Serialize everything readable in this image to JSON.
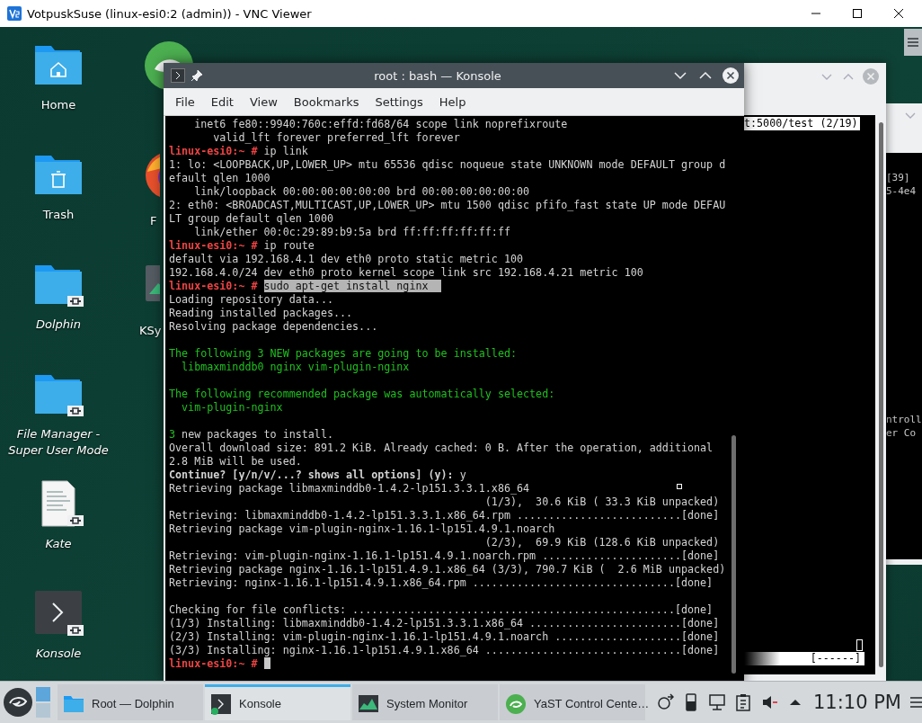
{
  "vnc_window": {
    "title": "VotpuskSuse (linux-esi0:2 (admin)) - VNC Viewer"
  },
  "desktop_icons": [
    {
      "label": "Home",
      "kind": "home",
      "link": false
    },
    {
      "label": "Trash",
      "kind": "trash",
      "link": false
    },
    {
      "label": "Dolphin",
      "kind": "folder",
      "link": true
    },
    {
      "label": "File Manager - Super User Mode",
      "kind": "folder",
      "link": true
    },
    {
      "label": "Kate",
      "kind": "document",
      "link": true
    },
    {
      "label": "Konsole",
      "kind": "terminal",
      "link": true
    }
  ],
  "hidden_icons": [
    {
      "kind": "app"
    },
    {
      "kind": "browser",
      "label": "F"
    },
    {
      "kind": "monitor",
      "label": "KSy"
    }
  ],
  "konsole": {
    "title": "root : bash — Konsole",
    "menu": [
      "File",
      "Edit",
      "View",
      "Bookmarks",
      "Settings",
      "Help"
    ],
    "lines": [
      {
        "kind": "output",
        "text": "    inet6 fe80::9940:760c:effd:fd68/64 scope link noprefixroute"
      },
      {
        "kind": "output",
        "text": "       valid_lft forever preferred_lft forever"
      },
      {
        "kind": "prompt",
        "prompt": "linux-esi0:~ #",
        "command": "ip link",
        "selected": false,
        "cursor": false
      },
      {
        "kind": "output",
        "text": "1: lo: <LOOPBACK,UP,LOWER_UP> mtu 65536 qdisc noqueue state UNKNOWN mode DEFAULT group d"
      },
      {
        "kind": "output",
        "text": "efault qlen 1000"
      },
      {
        "kind": "output",
        "text": "    link/loopback 00:00:00:00:00:00 brd 00:00:00:00:00:00"
      },
      {
        "kind": "output",
        "text": "2: eth0: <BROADCAST,MULTICAST,UP,LOWER_UP> mtu 1500 qdisc pfifo_fast state UP mode DEFAU"
      },
      {
        "kind": "output",
        "text": "LT group default qlen 1000"
      },
      {
        "kind": "output",
        "text": "    link/ether 00:0c:29:89:b9:5a brd ff:ff:ff:ff:ff:ff"
      },
      {
        "kind": "prompt",
        "prompt": "linux-esi0:~ #",
        "command": "ip route",
        "selected": false,
        "cursor": false
      },
      {
        "kind": "output",
        "text": "default via 192.168.4.1 dev eth0 proto static metric 100"
      },
      {
        "kind": "output",
        "text": "192.168.4.0/24 dev eth0 proto kernel scope link src 192.168.4.21 metric 100"
      },
      {
        "kind": "prompt",
        "prompt": "linux-esi0:~ #",
        "command": "sudo apt-get install nginx  ",
        "selected": true,
        "cursor": false
      },
      {
        "kind": "output",
        "text": "Loading repository data..."
      },
      {
        "kind": "output",
        "text": "Reading installed packages..."
      },
      {
        "kind": "output",
        "text": "Resolving package dependencies..."
      },
      {
        "kind": "blank"
      },
      {
        "kind": "notice",
        "text": "The following 3 NEW packages are going to be installed:"
      },
      {
        "kind": "notice",
        "text": "  libmaxminddb0 nginx vim-plugin-nginx"
      },
      {
        "kind": "blank"
      },
      {
        "kind": "notice",
        "text": "The following recommended package was automatically selected:"
      },
      {
        "kind": "notice",
        "text": "  vim-plugin-nginx"
      },
      {
        "kind": "blank"
      },
      {
        "kind": "summary",
        "count": "3",
        "text": "new packages to install."
      },
      {
        "kind": "output",
        "text": "Overall download size: 891.2 KiB. Already cached: 0 B. After the operation, additional"
      },
      {
        "kind": "output",
        "text": "2.8 MiB will be used."
      },
      {
        "kind": "output",
        "text": "**Continue? [y/n/v/...? shows all options] (y):** y"
      },
      {
        "kind": "output",
        "text": "Retrieving package libmaxminddb0-1.4.2-lp151.3.3.1.x86_64"
      },
      {
        "kind": "output",
        "text": "                                                  (1/3),  30.6 KiB ( 33.3 KiB unpacked)"
      },
      {
        "kind": "output",
        "text": "Retrieving: libmaxminddb0-1.4.2-lp151.3.3.1.x86_64.rpm ..........................[done]"
      },
      {
        "kind": "output",
        "text": "Retrieving package vim-plugin-nginx-1.16.1-lp151.4.9.1.noarch"
      },
      {
        "kind": "output",
        "text": "                                                  (2/3),  69.9 KiB (128.6 KiB unpacked)"
      },
      {
        "kind": "output",
        "text": "Retrieving: vim-plugin-nginx-1.16.1-lp151.4.9.1.noarch.rpm ......................[done]"
      },
      {
        "kind": "output",
        "text": "Retrieving package nginx-1.16.1-lp151.4.9.1.x86_64 (3/3), 790.7 KiB (  2.6 MiB unpacked)"
      },
      {
        "kind": "output",
        "text": "Retrieving: nginx-1.16.1-lp151.4.9.1.x86_64.rpm ................................[done]"
      },
      {
        "kind": "blank"
      },
      {
        "kind": "output",
        "text": "Checking for file conflicts: ...................................................[done]"
      },
      {
        "kind": "output",
        "text": "(1/3) Installing: libmaxminddb0-1.4.2-lp151.3.3.1.x86_64 ........................[done]"
      },
      {
        "kind": "output",
        "text": "(2/3) Installing: vim-plugin-nginx-1.16.1-lp151.4.9.1.noarch ....................[done]"
      },
      {
        "kind": "output",
        "text": "(3/3) Installing: nginx-1.16.1-lp151.4.9.1.x86_64 ...............................[done]"
      },
      {
        "kind": "prompt",
        "prompt": "linux-esi0:~ #",
        "selected": false,
        "cursor": true
      }
    ]
  },
  "back_terminal": {
    "header": "t:5000/test (2/19)",
    "footer": "[------]"
  },
  "side_terminal": {
    "top_lines": [
      "[39]",
      "5-4e4"
    ],
    "lower_lines": [
      "ntroll",
      "er Co"
    ]
  },
  "taskbar": {
    "tasks": [
      {
        "label": "Root — Dolphin",
        "kind": "folder",
        "selected": false
      },
      {
        "label": "Konsole",
        "kind": "terminal",
        "selected": true
      },
      {
        "label": "System Monitor",
        "kind": "monitor",
        "selected": false
      },
      {
        "label": "YaST Control Cente…",
        "kind": "yast",
        "selected": false
      }
    ],
    "clock": "11:10 PM"
  }
}
